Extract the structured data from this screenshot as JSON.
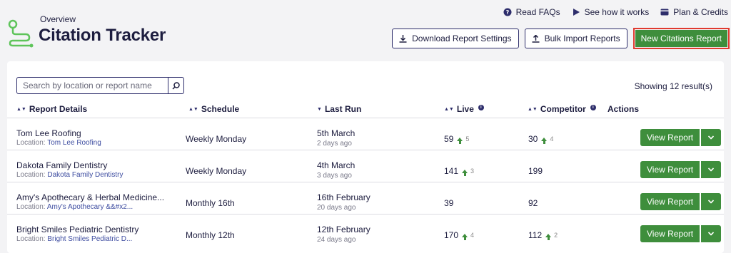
{
  "header": {
    "overview": "Overview",
    "title": "Citation Tracker"
  },
  "toplinks": [
    {
      "label": "Read FAQs",
      "icon": "question-circle-icon"
    },
    {
      "label": "See how it works",
      "icon": "play-icon"
    },
    {
      "label": "Plan & Credits",
      "icon": "credit-card-icon"
    }
  ],
  "toolbar": {
    "download_label": "Download Report Settings",
    "import_label": "Bulk Import Reports",
    "new_label": "New Citations Report"
  },
  "search": {
    "placeholder": "Search by location or report name"
  },
  "showing": "Showing 12 result(s)",
  "columns": {
    "report": "Report Details",
    "schedule": "Schedule",
    "last_run": "Last Run",
    "live": "Live",
    "competitor": "Competitor",
    "actions": "Actions"
  },
  "location_prefix": "Location:",
  "view_label": "View Report",
  "rows": [
    {
      "name": "Tom Lee Roofing",
      "location": "Tom Lee Roofing",
      "schedule": "Weekly Monday",
      "date": "5th March",
      "ago": "2 days ago",
      "live": "59",
      "live_delta": "5",
      "competitor": "30",
      "comp_delta": "4"
    },
    {
      "name": "Dakota Family Dentistry",
      "location": "Dakota Family Dentistry",
      "schedule": "Weekly Monday",
      "date": "4th March",
      "ago": "3 days ago",
      "live": "141",
      "live_delta": "3",
      "competitor": "199",
      "comp_delta": ""
    },
    {
      "name": "Amy's Apothecary & Herbal Medicine...",
      "location": "Amy's Apothecary &&#x2...",
      "schedule": "Monthly 16th",
      "date": "16th February",
      "ago": "20 days ago",
      "live": "39",
      "live_delta": "",
      "competitor": "92",
      "comp_delta": ""
    },
    {
      "name": "Bright Smiles Pediatric Dentistry",
      "location": "Bright Smiles Pediatric D...",
      "schedule": "Monthly 12th",
      "date": "12th February",
      "ago": "24 days ago",
      "live": "170",
      "live_delta": "4",
      "competitor": "112",
      "comp_delta": "2"
    }
  ],
  "colors": {
    "accent_green": "#3e8e3c",
    "navy": "#1d1d3f",
    "highlight_red": "#e03a2f",
    "logo_green": "#5ec45a"
  }
}
